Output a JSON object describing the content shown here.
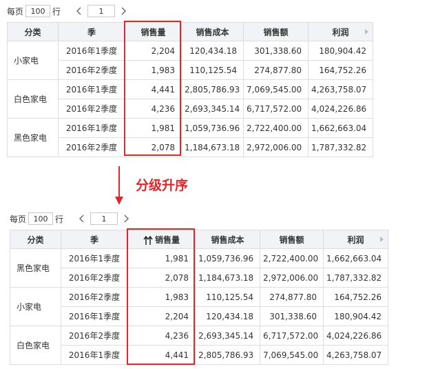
{
  "pager_top": {
    "per_page_label": "每页",
    "per_page_value": "100",
    "rows_label": "行",
    "page_value": "1"
  },
  "table_top": {
    "headers": [
      "分类",
      "季",
      "销售量",
      "销售成本",
      "销售额",
      "利润"
    ],
    "rows": [
      {
        "group": "小家电",
        "quarter": "2016年1季度",
        "qty": "2,204",
        "cost": "120,434.18",
        "sales": "301,338.60",
        "profit": "180,904.42"
      },
      {
        "quarter": "2016年2季度",
        "qty": "1,983",
        "cost": "110,125.54",
        "sales": "274,877.80",
        "profit": "164,752.26"
      },
      {
        "group": "白色家电",
        "quarter": "2016年1季度",
        "qty": "4,441",
        "cost": "2,805,786.93",
        "sales": "7,069,545.00",
        "profit": "4,263,758.07"
      },
      {
        "quarter": "2016年2季度",
        "qty": "4,236",
        "cost": "2,693,345.14",
        "sales": "6,717,572.00",
        "profit": "4,024,226.86"
      },
      {
        "group": "黑色家电",
        "quarter": "2016年1季度",
        "qty": "1,981",
        "cost": "1,059,736.96",
        "sales": "2,722,400.00",
        "profit": "1,662,663.04"
      },
      {
        "quarter": "2016年2季度",
        "qty": "2,078",
        "cost": "1,184,673.18",
        "sales": "2,972,006.00",
        "profit": "1,787,332.82"
      }
    ]
  },
  "annotation": {
    "label": "分级升序",
    "accent_color": "#e0262b"
  },
  "pager_bottom": {
    "per_page_label": "每页",
    "per_page_value": "100",
    "rows_label": "行",
    "page_value": "1"
  },
  "table_bottom": {
    "headers": [
      "分类",
      "季",
      "销售量",
      "销售成本",
      "销售额",
      "利润"
    ],
    "rows": [
      {
        "group": "黑色家电",
        "quarter": "2016年1季度",
        "qty": "1,981",
        "cost": "1,059,736.96",
        "sales": "2,722,400.00",
        "profit": "1,662,663.04"
      },
      {
        "quarter": "2016年2季度",
        "qty": "2,078",
        "cost": "1,184,673.18",
        "sales": "2,972,006.00",
        "profit": "1,787,332.82"
      },
      {
        "group": "小家电",
        "quarter": "2016年2季度",
        "qty": "1,983",
        "cost": "110,125.54",
        "sales": "274,877.80",
        "profit": "164,752.26"
      },
      {
        "quarter": "2016年1季度",
        "qty": "2,204",
        "cost": "120,434.18",
        "sales": "301,338.60",
        "profit": "180,904.42"
      },
      {
        "group": "白色家电",
        "quarter": "2016年2季度",
        "qty": "4,236",
        "cost": "2,693,345.14",
        "sales": "6,717,572.00",
        "profit": "4,024,226.86"
      },
      {
        "quarter": "2016年1季度",
        "qty": "4,441",
        "cost": "2,805,786.93",
        "sales": "7,069,545.00",
        "profit": "4,263,758.07"
      }
    ]
  }
}
